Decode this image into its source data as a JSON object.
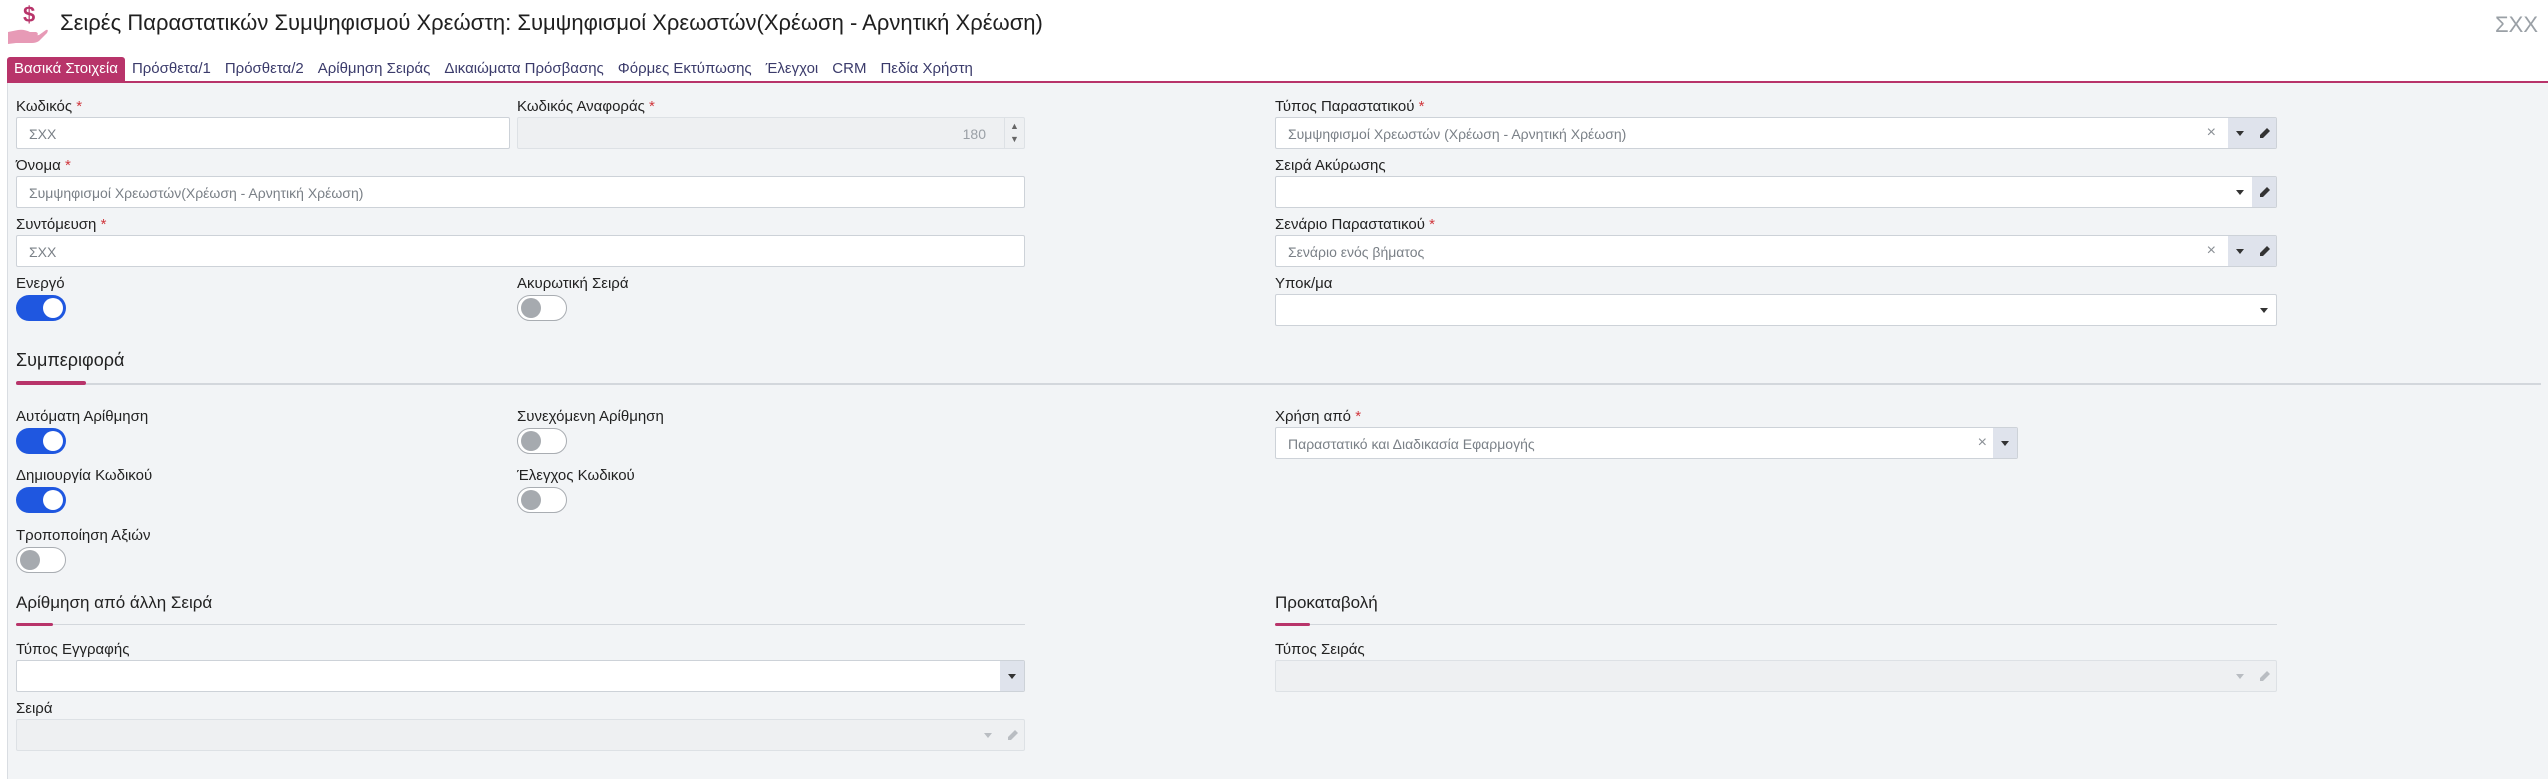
{
  "header": {
    "title": "Σειρές Παραστατικών Συμψηφισμού Χρεώστη: Συμψηφισμοί Χρεωστών(Χρέωση - Αρνητική Χρέωση)",
    "code": "ΣΧΧ",
    "app_icon": "money-hand-icon"
  },
  "tabs": [
    {
      "label": "Βασικά Στοιχεία",
      "active": true
    },
    {
      "label": "Πρόσθετα/1"
    },
    {
      "label": "Πρόσθετα/2"
    },
    {
      "label": "Αρίθμηση Σειράς"
    },
    {
      "label": "Δικαιώματα Πρόσβασης"
    },
    {
      "label": "Φόρμες Εκτύπωσης"
    },
    {
      "label": "Έλεγχοι"
    },
    {
      "label": "CRM"
    },
    {
      "label": "Πεδία Χρήστη"
    }
  ],
  "required_mark": "*",
  "form": {
    "code": {
      "label": "Κωδικός",
      "value": "ΣΧΧ"
    },
    "ref_code": {
      "label": "Κωδικός Αναφοράς",
      "value": "180"
    },
    "doc_type": {
      "label": "Τύπος Παραστατικού",
      "value": "Συμψηφισμοί Χρεωστών (Χρέωση - Αρνητική Χρέωση)"
    },
    "name": {
      "label": "Όνομα",
      "value": "Συμψηφισμοί Χρεωστών(Χρέωση - Αρνητική Χρέωση)"
    },
    "cancel_series": {
      "label": "Σειρά Ακύρωσης",
      "value": ""
    },
    "short": {
      "label": "Συντόμευση",
      "value": "ΣΧΧ"
    },
    "scenario": {
      "label": "Σενάριο Παραστατικού",
      "value": "Σενάριο ενός βήματος"
    },
    "active": {
      "label": "Ενεργό",
      "on": true
    },
    "cancel_toggle": {
      "label": "Ακυρωτική Σειρά",
      "on": false
    },
    "branch": {
      "label": "Υποκ/μα",
      "value": ""
    }
  },
  "behavior": {
    "title": "Συμπεριφορά",
    "auto_numbering": {
      "label": "Αυτόματη Αρίθμηση",
      "on": true
    },
    "continuous_numbering": {
      "label": "Συνεχόμενη Αρίθμηση",
      "on": false
    },
    "create_code": {
      "label": "Δημιουργία Κωδικού",
      "on": true
    },
    "check_code": {
      "label": "Έλεγχος Κωδικού",
      "on": false
    },
    "modify_values": {
      "label": "Τροποποίηση Αξιών",
      "on": false
    },
    "used_by": {
      "label": "Χρήση από",
      "value": "Παραστατικό και Διαδικασία Εφαρμογής"
    }
  },
  "numbering_other": {
    "title": "Αρίθμηση από άλλη Σειρά",
    "record_type": {
      "label": "Τύπος Εγγραφής",
      "value": ""
    },
    "series": {
      "label": "Σειρά",
      "value": ""
    }
  },
  "advance": {
    "title": "Προκαταβολή",
    "series_type": {
      "label": "Τύπος Σειράς",
      "value": ""
    }
  },
  "colors": {
    "accent": "#b8346a",
    "toggle_on": "#1f57e0",
    "panel_bg": "#f2f4f6"
  }
}
